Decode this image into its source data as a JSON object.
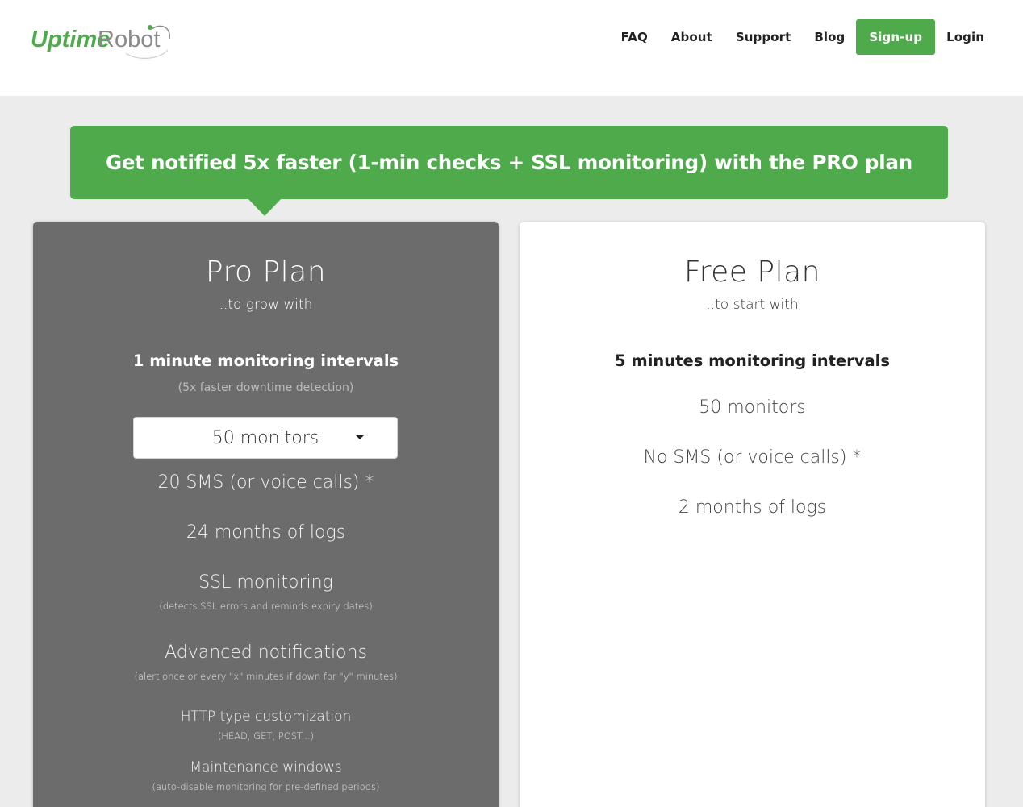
{
  "brand": {
    "name_part1": "Uptime",
    "name_part2": "Robot",
    "green": "#4eaa4b",
    "grey": "#888888"
  },
  "nav": {
    "items": [
      {
        "label": "FAQ"
      },
      {
        "label": "About"
      },
      {
        "label": "Support"
      },
      {
        "label": "Blog"
      }
    ],
    "signup_label": "Sign-up",
    "login_label": "Login"
  },
  "banner": {
    "text": "Get notified 5x faster (1-min checks + SSL monitoring) with the PRO plan"
  },
  "pro_plan": {
    "title": "Pro Plan",
    "subtitle": "..to grow with",
    "interval": "1 minute monitoring intervals",
    "interval_note": "(5x faster downtime detection)",
    "monitors_selected": "50 monitors",
    "sms": "20 SMS (or voice calls) *",
    "logs": "24 months of logs",
    "ssl": "SSL monitoring",
    "ssl_note": "(detects SSL errors and reminds expiry dates)",
    "notifications": "Advanced notifications",
    "notifications_note": "(alert once or every \"x\" minutes if down for \"y\" minutes)",
    "http": "HTTP type customization",
    "http_note": "(HEAD, GET, POST...)",
    "maintenance": "Maintenance windows",
    "maintenance_note": "(auto-disable monitoring for pre-defined periods)"
  },
  "free_plan": {
    "title": "Free Plan",
    "subtitle": "..to start with",
    "interval": "5 minutes monitoring intervals",
    "monitors": "50 monitors",
    "sms": "No SMS (or voice calls) *",
    "logs": "2 months of logs"
  }
}
